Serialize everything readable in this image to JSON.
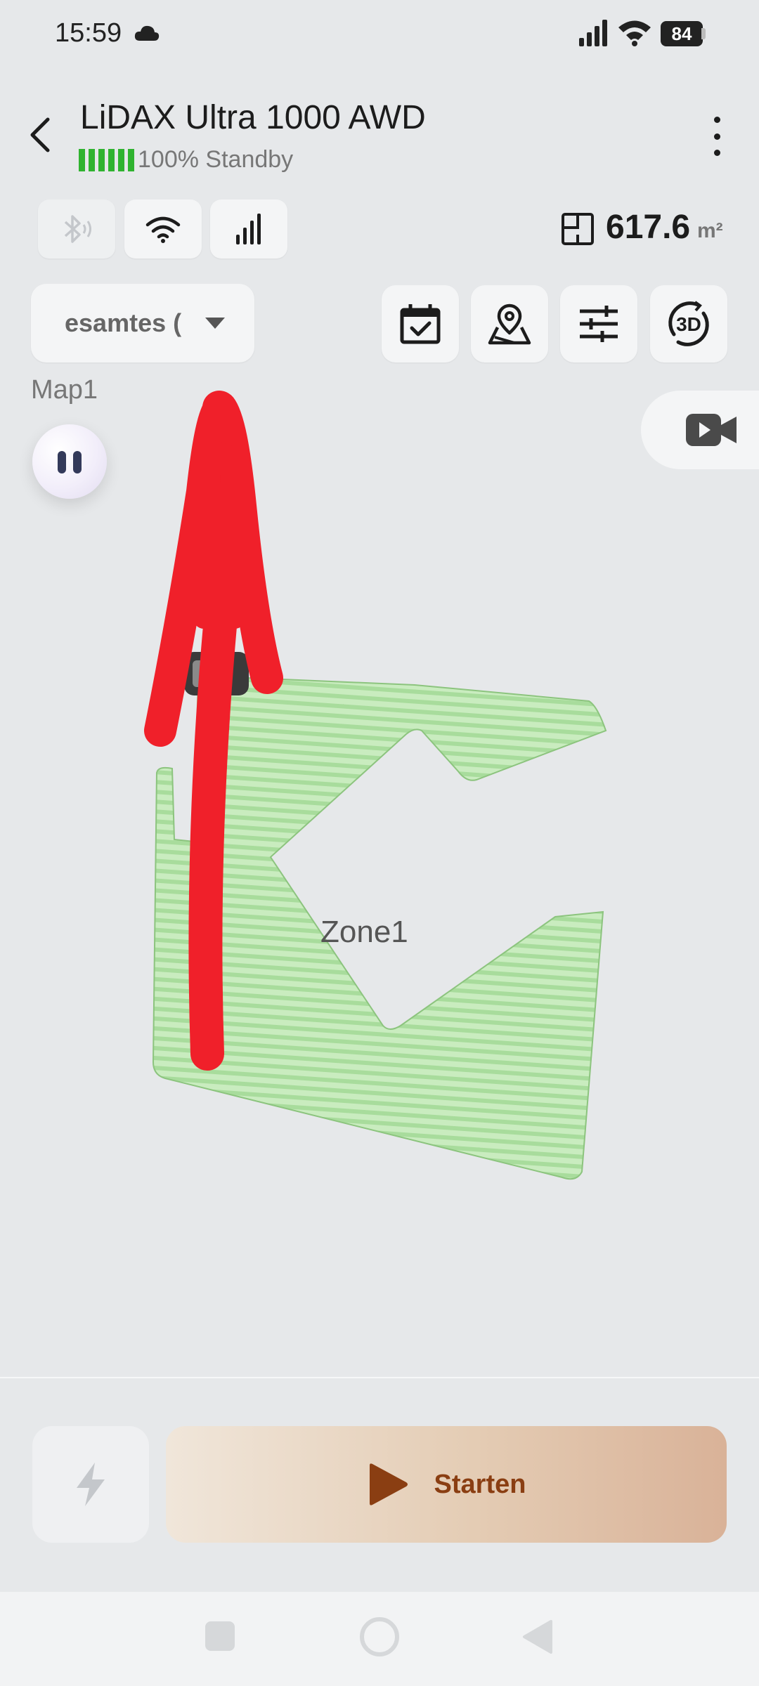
{
  "status_bar": {
    "time": "15:59",
    "battery": "84",
    "icons": [
      "cloud-icon",
      "cellular-signal-icon",
      "wifi-icon",
      "battery-icon"
    ]
  },
  "header": {
    "title": "LiDAX Ultra 1000 AWD",
    "battery_text": "100% Standby",
    "battery_level": 1.0,
    "battery_color": "#2fb32f"
  },
  "connectivity": {
    "items": [
      "bluetooth-icon",
      "wifi-icon",
      "cellular-icon"
    ]
  },
  "area": {
    "value": "617.6",
    "unit": "m²"
  },
  "map_selector": {
    "selected": "esamtes (",
    "map_name": "Map1"
  },
  "toolbar": {
    "icons": [
      "calendar-check-icon",
      "map-pin-icon",
      "sliders-icon",
      "rotate-3d-icon"
    ],
    "view_3d_label": "3D"
  },
  "map": {
    "zone_label": "Zone1",
    "zone_color": "#a8dc9c",
    "annotation_color": "#f0202a"
  },
  "actions": {
    "start_label": "Starten",
    "start_color": "#8a3e12"
  }
}
